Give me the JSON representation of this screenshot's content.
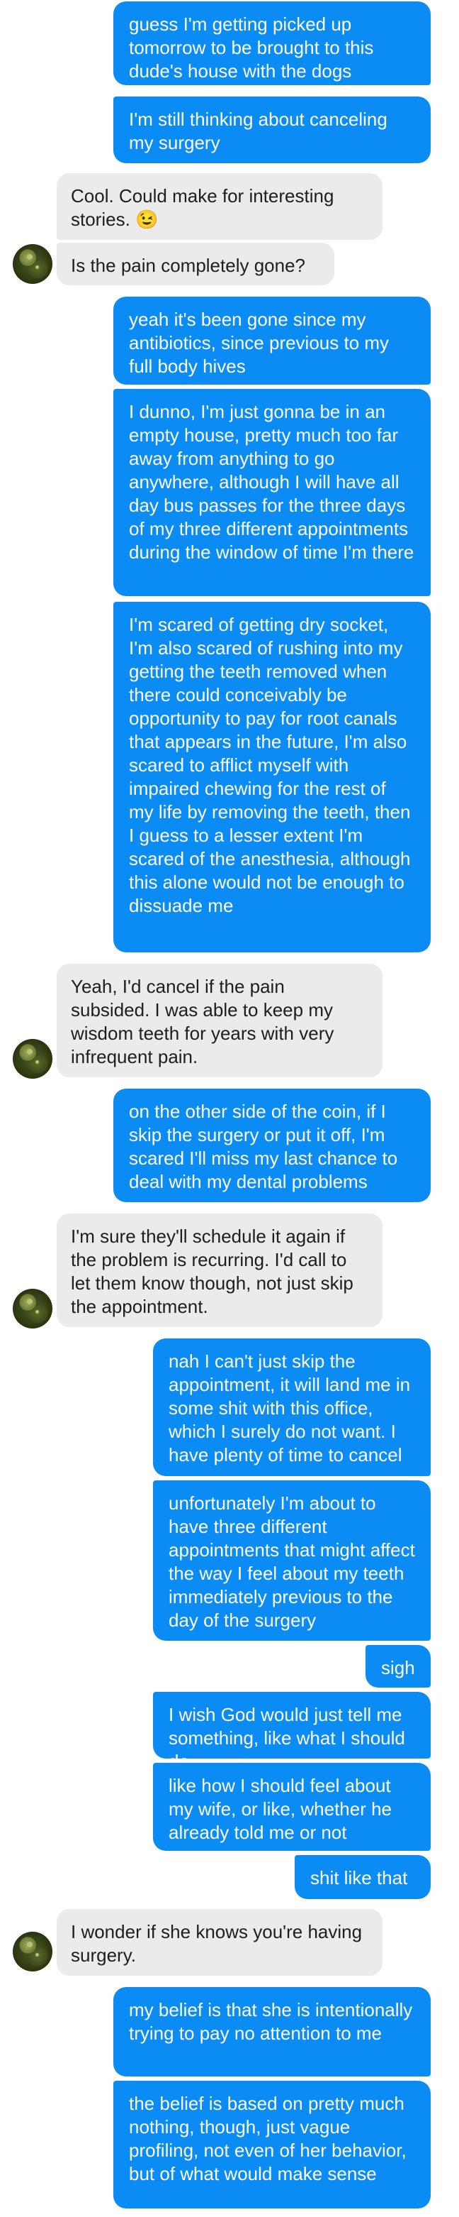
{
  "messages": [
    {
      "from": "me",
      "text": "guess I'm getting picked up tomorrow to be brought to this dude's house with the dogs"
    },
    {
      "from": "me",
      "text": "I'm still thinking about canceling my surgery"
    },
    {
      "from": "friend",
      "text": "Cool. Could make for interesting stories. 😉"
    },
    {
      "from": "friend",
      "text": "Is the pain completely gone?"
    },
    {
      "from": "me",
      "text": "yeah it's been gone since my antibiotics, since previous to my full body hives"
    },
    {
      "from": "me",
      "text": "I dunno, I'm just gonna be in an empty house, pretty much too far away from anything to go anywhere, although I will have all day bus passes for the three days of my three different appointments during the window of time I'm there"
    },
    {
      "from": "me",
      "text": "I'm scared of getting dry socket, I'm also scared of rushing into my getting the teeth removed when there could conceivably be opportunity to pay for root canals that appears in the future, I'm also scared to afflict myself with impaired chewing for the rest of my life by removing the teeth, then I guess to a lesser extent I'm scared of the anesthesia, although this alone would not be enough to dissuade me"
    },
    {
      "from": "friend",
      "text": "Yeah, I'd cancel if the pain subsided. I was able to keep my wisdom teeth for years with very infrequent pain."
    },
    {
      "from": "me",
      "text": "on the other side of the coin, if I skip the surgery or put it off, I'm scared I'll miss my last chance to deal with my dental problems"
    },
    {
      "from": "friend",
      "text": "I'm sure they'll schedule it again if the problem is recurring. I'd call to let them know though, not just skip the appointment."
    },
    {
      "from": "me",
      "text": "nah I can't just skip the appointment, it will land me in some shit with this office, which I surely do not want. I have plenty of time to cancel"
    },
    {
      "from": "me",
      "text": "unfortunately I'm about to have three different appointments that might affect the way I feel about my teeth immediately previous to the day of the surgery"
    },
    {
      "from": "me",
      "text": "sigh"
    },
    {
      "from": "me",
      "text": "I wish God would just tell me something, like what I should do"
    },
    {
      "from": "me",
      "text": "like how I should feel about my wife, or like, whether he already told me or not"
    },
    {
      "from": "me",
      "text": "shit like that"
    },
    {
      "from": "friend",
      "text": "I wonder if she knows you're having surgery."
    },
    {
      "from": "me",
      "text": "my belief is that she is intentionally trying to pay no attention to me"
    },
    {
      "from": "me",
      "text": "the belief is based on pretty much nothing, though, just vague profiling, not even of her behavior, but of what would make sense"
    }
  ],
  "colors": {
    "outgoing_bubble": "#0a8cf4",
    "outgoing_text": "#ffffff",
    "incoming_bubble": "#ebebeb",
    "incoming_text": "#1e1e1e"
  }
}
